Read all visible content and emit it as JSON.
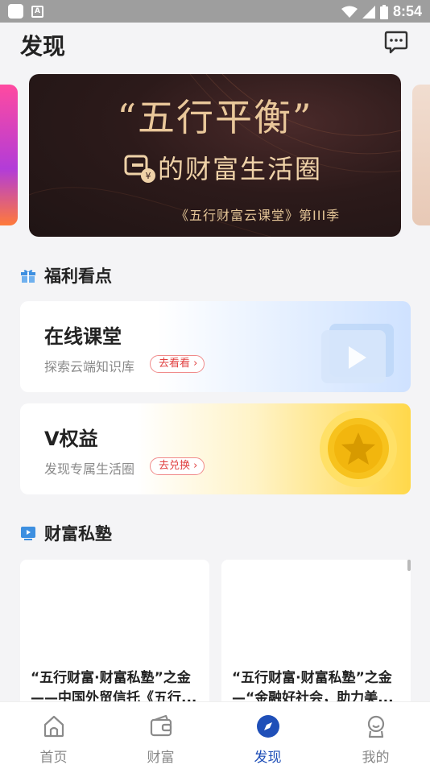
{
  "status_bar": {
    "time": "8:54"
  },
  "header": {
    "title": "发现"
  },
  "banner": {
    "title": "“五行平衡”",
    "subtitle": "的财富生活圈",
    "footer": "《五行财富云课堂》第III季"
  },
  "welfare_section": {
    "title": "福利看点"
  },
  "cards": [
    {
      "title": "在线课堂",
      "subtitle": "探索云端知识库",
      "action": "去看看"
    },
    {
      "title": "V权益",
      "subtitle": "发现专属生活圈",
      "action": "去兑换"
    }
  ],
  "academy_section": {
    "title": "财富私塾"
  },
  "articles": [
    {
      "title": "“五行财富·财富私塾”之金——中国外贸信托《五行..."
    },
    {
      "title": "“五行财富·财富私塾”之金—“金融好社会，助力美..."
    }
  ],
  "bottom_nav": [
    {
      "label": "首页",
      "icon": "home-icon"
    },
    {
      "label": "财富",
      "icon": "wallet-icon"
    },
    {
      "label": "发现",
      "icon": "compass-icon",
      "active": true
    },
    {
      "label": "我的",
      "icon": "profile-icon"
    }
  ],
  "colors": {
    "accent": "#1f4fb8",
    "pill_red": "#e04040",
    "banner_gold": "#e9c79a"
  }
}
